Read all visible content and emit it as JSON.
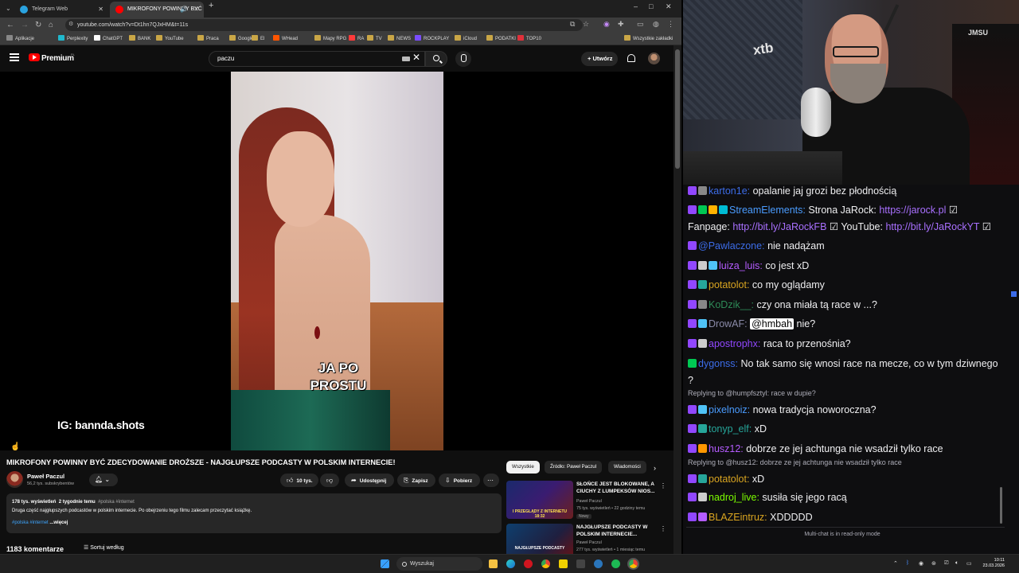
{
  "browser": {
    "tabs": [
      {
        "title": "Telegram Web",
        "color": "#2aa3e0",
        "active": false
      },
      {
        "title": "MIKROFONY POWINNY BYĆ",
        "color": "#ff0000",
        "active": true
      }
    ],
    "window_controls": [
      "–",
      "□",
      "✕"
    ],
    "url": "youtube.com/watch?v=Dt1hn7QJxHM&t=11s",
    "bookmarks": [
      {
        "label": "Aplikacje",
        "color": "#888888"
      },
      {
        "label": "Perplexity",
        "color": "#20b8cd"
      },
      {
        "label": "ChatGPT",
        "color": "#ffffff"
      },
      {
        "label": "BANK",
        "color": "#c9a646"
      },
      {
        "label": "YouTube",
        "color": "#c9a646"
      },
      {
        "label": "Praca",
        "color": "#c9a646"
      },
      {
        "label": "Google",
        "color": "#c9a646"
      },
      {
        "label": "El",
        "color": "#c9a646"
      },
      {
        "label": "WHead",
        "color": "#ff5500"
      },
      {
        "label": "Mapy RPG",
        "color": "#c9a646"
      },
      {
        "label": "RA",
        "color": "#ff3a3a"
      },
      {
        "label": "TV",
        "color": "#c9a646"
      },
      {
        "label": "NEWS",
        "color": "#c9a646"
      },
      {
        "label": "ROCKPLAY",
        "color": "#7a4dff"
      },
      {
        "label": "iCloud",
        "color": "#c9a646"
      },
      {
        "label": "PODATKI",
        "color": "#c9a646"
      },
      {
        "label": "TOP10",
        "color": "#e0303a"
      },
      {
        "label": "Wszystkie zakładki",
        "color": "#c9a646"
      }
    ]
  },
  "youtube": {
    "brand": "Premium",
    "country_code": "PL",
    "search_value": "paczu",
    "create_label": "Utwórz",
    "video": {
      "caption_line1": "JA PO",
      "caption_line2": "PROSTU",
      "watermark": "IG: bannda.shots"
    },
    "title": "MIKROFONY POWINNY BYĆ ZDECYDOWANIE DROŻSZE - NAJGŁUPSZE PODCASTY W POLSKIM INTERNECIE!",
    "channel": {
      "name": "Paweł Paczul",
      "subscribers": "56,2 tys. subskrybentów"
    },
    "actions": {
      "likes": "10 tys.",
      "share": "Udostępnij",
      "save": "Zapisz",
      "download": "Pobierz"
    },
    "description": {
      "views": "178 tys. wyświetleń",
      "date": "2 tygodnie temu",
      "hashtags_top": "#polska #internet",
      "text": "Druga część najgłupszych podcastów w polskim internecie. Po obejrzeniu tego filmu zalecam przeczytać książkę.",
      "hashtags_bottom": "#polska #internet",
      "more": "...więcej"
    },
    "comments_count": "1183 komentarze",
    "sort_label": "Sortuj według",
    "chips": [
      "Wszystkie",
      "Źródło: Paweł Paczul",
      "Wiadomości"
    ],
    "recommendations": [
      {
        "title": "SŁOŃCE JEST BLOKOWANE, A CIUCHY Z LUMPEKSÓW NIOS...",
        "channel": "Paweł Paczul",
        "meta": "75 tys. wyświetleń • 22 godziny temu",
        "badge": "Nowy",
        "thumb_text": "I PRZEGLĄDY Z INTERNETU 18:32"
      },
      {
        "title": "NAJGŁUPSZE PODCASTY W POLSKIM INTERNECIE...",
        "channel": "Paweł Paczul",
        "meta": "277 tys. wyświetleń • 1 miesiąc temu",
        "badge": "",
        "thumb_text": "NAJGŁUPSZE PODCASTY"
      }
    ]
  },
  "webcam": {
    "logo_text": "xtb",
    "chair_text": "JMSU"
  },
  "chat": {
    "messages": [
      {
        "user": "karton1e:",
        "user_color": "#3c6ce8",
        "text": "opalanie jaj grozi bez płodnością",
        "badges": [
          "#9147ff",
          "#888888"
        ]
      },
      {
        "user": "StreamElements:",
        "user_color": "#4a9cff",
        "text": "Strona JaRock:",
        "link": "https://jarock.pl",
        "badges": [
          "#9147ff",
          "#00c853",
          "#ffb300",
          "#00bcd4"
        ]
      },
      {
        "text": "Fanpage:",
        "link": "http://bit.ly/JaRockFB",
        "text2": "YouTube:",
        "link2": "http://bit.ly/JaRockYT"
      },
      {
        "user": "@Pawlaczone:",
        "user_color": "#3c6ce8",
        "text": "nie nadążam",
        "badges": [
          "#9147ff"
        ]
      },
      {
        "user": "luiza_luis:",
        "user_color": "#b55cff",
        "text": "co jest xD",
        "badges": [
          "#9147ff",
          "#cccccc",
          "#4fc3f7"
        ]
      },
      {
        "user": "potatolot:",
        "user_color": "#daa520",
        "text": "co my oglądamy",
        "badges": [
          "#9147ff",
          "#26a69a"
        ]
      },
      {
        "user": "KoDzik__:",
        "user_color": "#2e8b57",
        "text": "czy ona miała tą race w ...?",
        "badges": [
          "#9147ff",
          "#888888"
        ]
      },
      {
        "user": "DrowAF:",
        "user_color": "#8a8aa8",
        "mention": "@hmbah",
        "text": "nie?",
        "badges": [
          "#9147ff",
          "#4fc3f7"
        ]
      },
      {
        "user": "apostrophx:",
        "user_color": "#9147ff",
        "text": "raca to przenośnia?",
        "badges": [
          "#9147ff",
          "#cccccc"
        ]
      },
      {
        "user": "dygonss:",
        "user_color": "#3c6ce8",
        "text": "No tak samo się wnosi race na mecze, co w tym dziwnego ?",
        "badges": [
          "#00c853"
        ]
      },
      {
        "reply": "Replying to @humpfsztyl: race w dupie?"
      },
      {
        "user": "pixelnoiz:",
        "user_color": "#4a9cff",
        "text": "nowa tradycja noworoczna?",
        "badges": [
          "#9147ff",
          "#4fc3f7"
        ]
      },
      {
        "user": "tonyp_elf:",
        "user_color": "#26a69a",
        "text": "xD",
        "badges": [
          "#9147ff",
          "#26a69a"
        ]
      },
      {
        "user": "husz12:",
        "user_color": "#b55cff",
        "text": "dobrze ze jej achtunga nie wsadził tylko race",
        "badges": [
          "#9147ff",
          "#ff9800"
        ]
      },
      {
        "reply": "Replying to @husz12: dobrze ze jej achtunga nie wsadził tylko race"
      },
      {
        "user": "potatolot:",
        "user_color": "#daa520",
        "text": "xD",
        "badges": [
          "#9147ff",
          "#26a69a"
        ]
      },
      {
        "user": "nadroj_live:",
        "user_color": "#7cfc00",
        "text": "susiła się jego racą",
        "badges": [
          "#9147ff",
          "#cccccc"
        ]
      },
      {
        "user": "BLAZEintruz:",
        "user_color": "#daa520",
        "text": "XDDDDD",
        "badges": [
          "#9147ff",
          "#b55cff"
        ]
      }
    ],
    "footer": "Multi-chat is in read-only mode"
  },
  "taskbar": {
    "search_label": "Wyszukaj",
    "time": "10:11",
    "date": "23.03.2026"
  }
}
